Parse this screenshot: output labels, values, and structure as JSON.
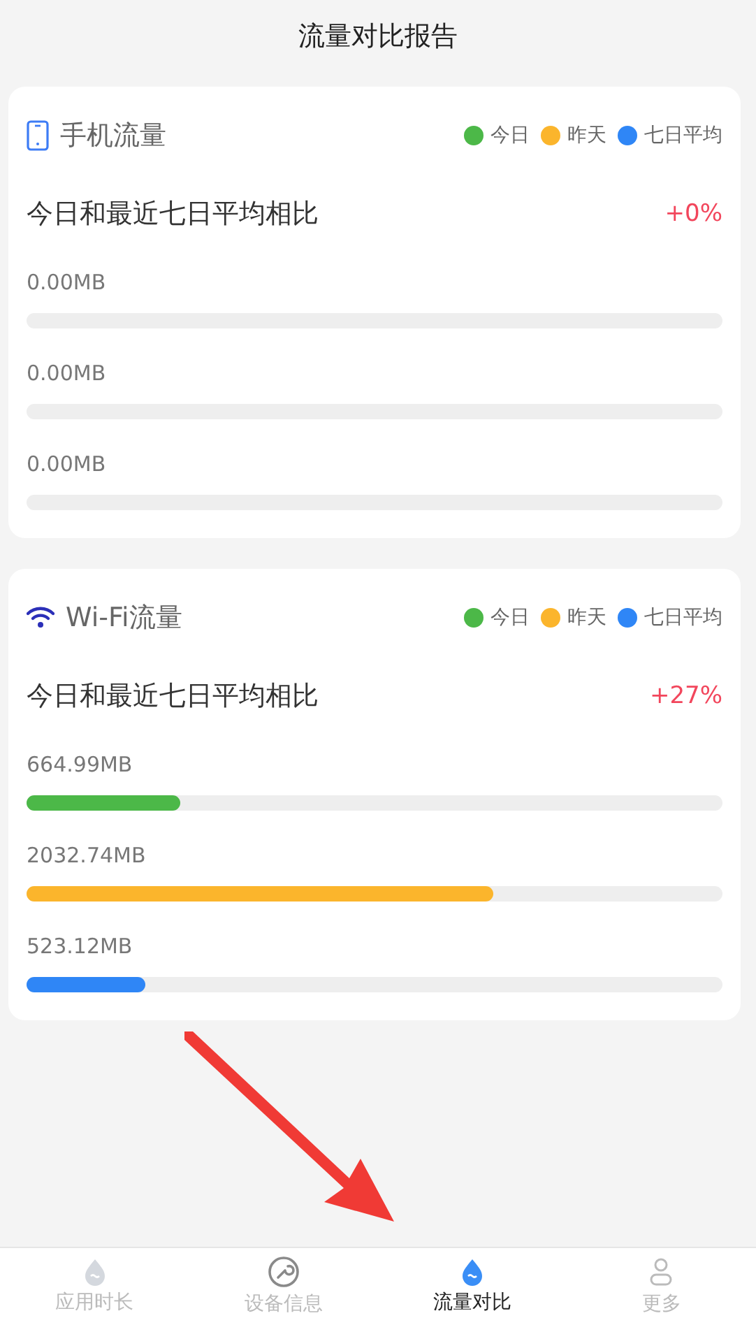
{
  "title": "流量对比报告",
  "cards": [
    {
      "kind": "phone",
      "title": "手机流量",
      "legend": [
        {
          "label": "今日",
          "color": "#4cb848"
        },
        {
          "label": "昨天",
          "color": "#fbb52c"
        },
        {
          "label": "七日平均",
          "color": "#2f86f6"
        }
      ],
      "comparison": {
        "label": "今日和最近七日平均相比",
        "value": "+0%"
      },
      "bars": [
        {
          "reading": "0.00MB"
        },
        {
          "reading": "0.00MB"
        },
        {
          "reading": "0.00MB"
        }
      ]
    },
    {
      "kind": "wifi",
      "title": "Wi-Fi流量",
      "legend": [
        {
          "label": "今日",
          "color": "#4cb848"
        },
        {
          "label": "昨天",
          "color": "#fbb52c"
        },
        {
          "label": "七日平均",
          "color": "#2f86f6"
        }
      ],
      "comparison": {
        "label": "今日和最近七日平均相比",
        "value": "+27%"
      },
      "bars": [
        {
          "reading": "664.99MB",
          "level": 0.22
        },
        {
          "reading": "2032.74MB",
          "level": 0.67
        },
        {
          "reading": "523.12MB",
          "level": 0.17
        }
      ]
    }
  ],
  "tabs": [
    {
      "label": "应用时长",
      "kind": "drop",
      "selected": false
    },
    {
      "label": "设备信息",
      "kind": "wrench",
      "selected": false
    },
    {
      "label": "流量对比",
      "kind": "drop",
      "selected": true
    },
    {
      "label": "更多",
      "kind": "person",
      "selected": false
    }
  ]
}
